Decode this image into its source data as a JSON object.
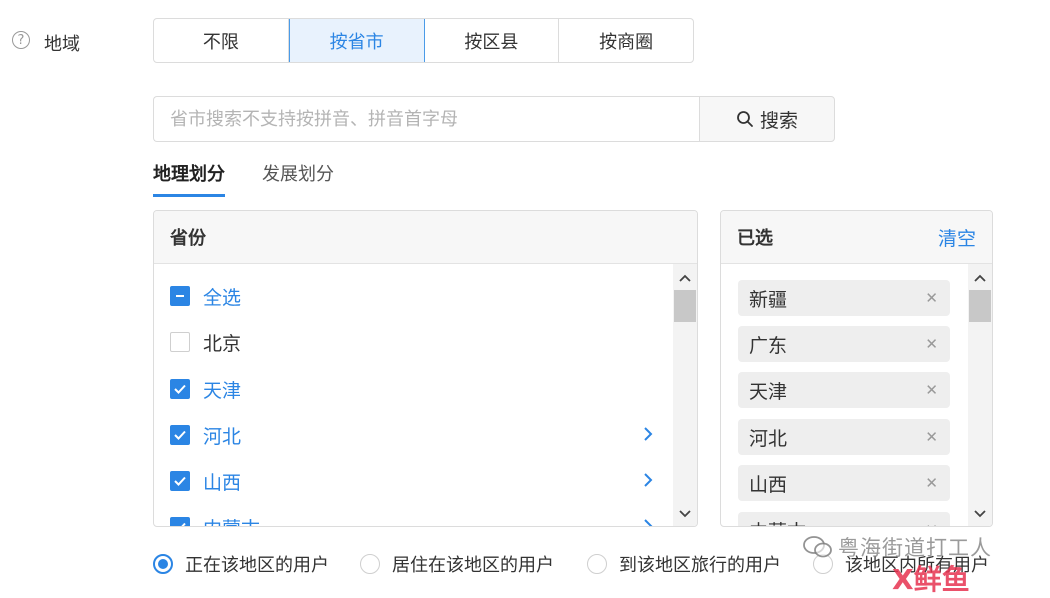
{
  "region": {
    "label": "地域",
    "help_icon": "question-circle-icon"
  },
  "segment": {
    "options": [
      "不限",
      "按省市",
      "按区县",
      "按商圈"
    ],
    "active_index": 1
  },
  "search": {
    "placeholder": "省市搜索不支持按拼音、拼音首字母",
    "button_label": "搜索",
    "button_icon": "search-icon"
  },
  "tabs": [
    {
      "label": "地理划分",
      "active": true
    },
    {
      "label": "发展划分",
      "active": false
    }
  ],
  "province_panel": {
    "title": "省份",
    "items": [
      {
        "label": "全选",
        "state": "partial",
        "has_children": false
      },
      {
        "label": "北京",
        "state": "unchecked",
        "has_children": false
      },
      {
        "label": "天津",
        "state": "checked",
        "has_children": false
      },
      {
        "label": "河北",
        "state": "checked",
        "has_children": true
      },
      {
        "label": "山西",
        "state": "checked",
        "has_children": true
      },
      {
        "label": "内蒙古",
        "state": "checked",
        "has_children": true
      }
    ]
  },
  "selected_panel": {
    "title": "已选",
    "clear_label": "清空",
    "items": [
      "新疆",
      "广东",
      "天津",
      "河北",
      "山西",
      "内蒙古"
    ]
  },
  "user_type": {
    "options": [
      "正在该地区的用户",
      "居住在该地区的用户",
      "到该地区旅行的用户",
      "该地区内所有用户"
    ],
    "selected_index": 0
  },
  "watermark": {
    "text": "粤海街道打工人",
    "logo": "X鲜鱼"
  },
  "colors": {
    "accent": "#2b85e4",
    "active_bg": "#e8f2fd",
    "chip_bg": "#eeeeee"
  }
}
